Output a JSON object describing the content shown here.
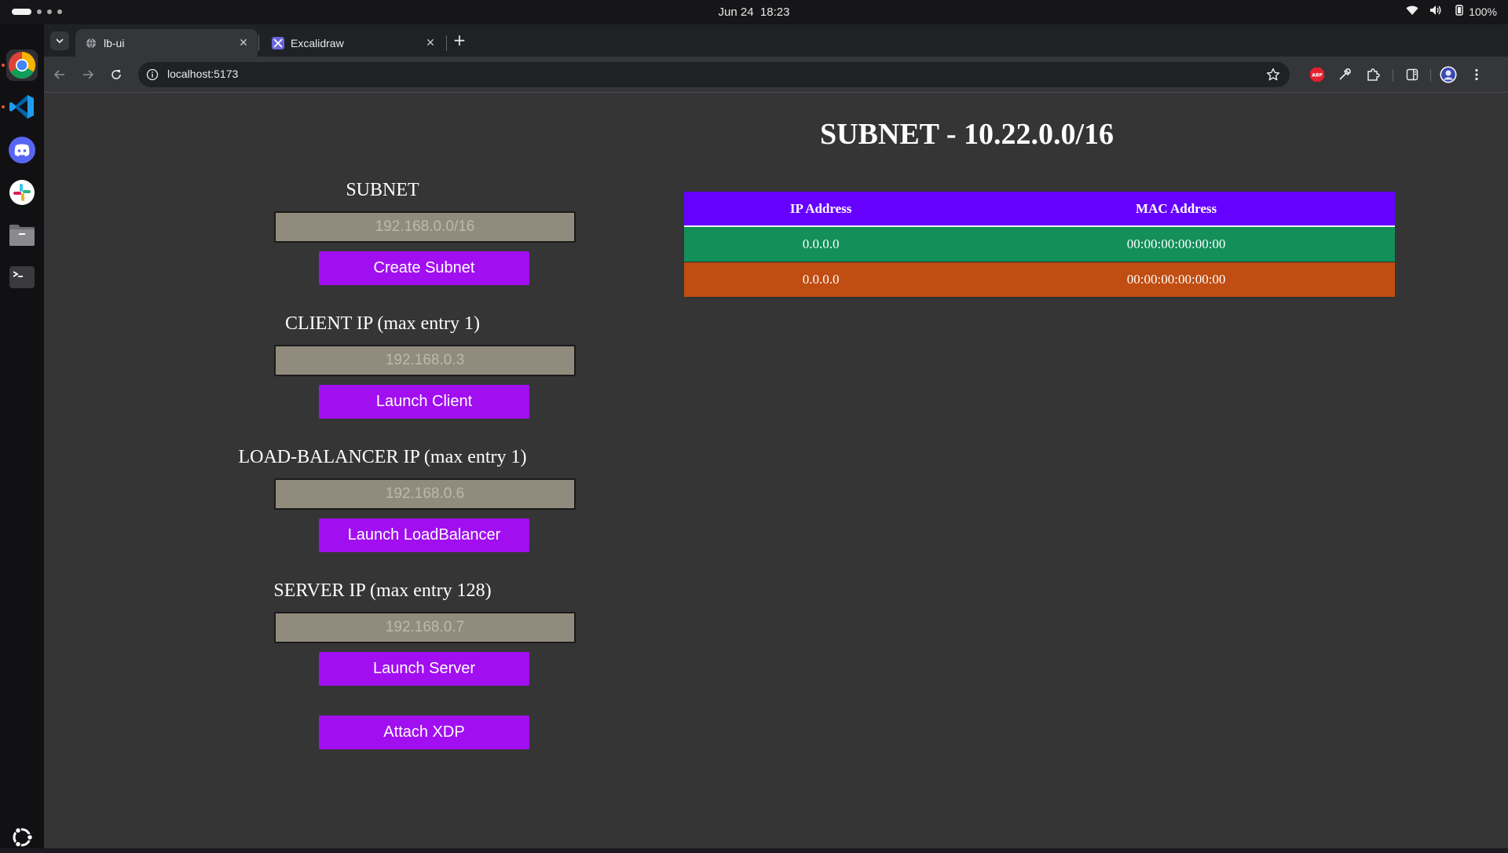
{
  "system": {
    "date": "Jun 24",
    "time": "18:23",
    "battery": "100%"
  },
  "dock": {
    "apps": [
      "chrome-icon",
      "vscode-icon",
      "discord-icon",
      "slack-icon",
      "files-icon",
      "terminal-icon",
      "ubuntu-icon"
    ]
  },
  "browser": {
    "tabs": [
      {
        "title": "lb-ui",
        "active": true
      },
      {
        "title": "Excalidraw",
        "active": false
      }
    ],
    "url": "localhost:5173"
  },
  "form": {
    "subnet": {
      "label": "SUBNET",
      "placeholder": "192.168.0.0/16",
      "button": "Create Subnet"
    },
    "client": {
      "label": "CLIENT IP (max entry 1)",
      "placeholder": "192.168.0.3",
      "button": "Launch Client"
    },
    "loadbalancer": {
      "label": "LOAD-BALANCER IP (max entry 1)",
      "placeholder": "192.168.0.6",
      "button": "Launch LoadBalancer"
    },
    "server": {
      "label": "SERVER IP (max entry 128)",
      "placeholder": "192.168.0.7",
      "button": "Launch Server"
    },
    "attach_button": "Attach XDP"
  },
  "subnet_panel": {
    "title": "SUBNET - 10.22.0.0/16",
    "columns": [
      "IP Address",
      "MAC Address"
    ],
    "rows": [
      {
        "ip": "0.0.0.0",
        "mac": "00:00:00:00:00:00",
        "color": "#138f5a"
      },
      {
        "ip": "0.0.0.0",
        "mac": "00:00:00:00:00:00",
        "color": "#c04d12"
      }
    ]
  },
  "colors": {
    "accent_button": "#a10ff0",
    "table_header": "#6600ff"
  }
}
